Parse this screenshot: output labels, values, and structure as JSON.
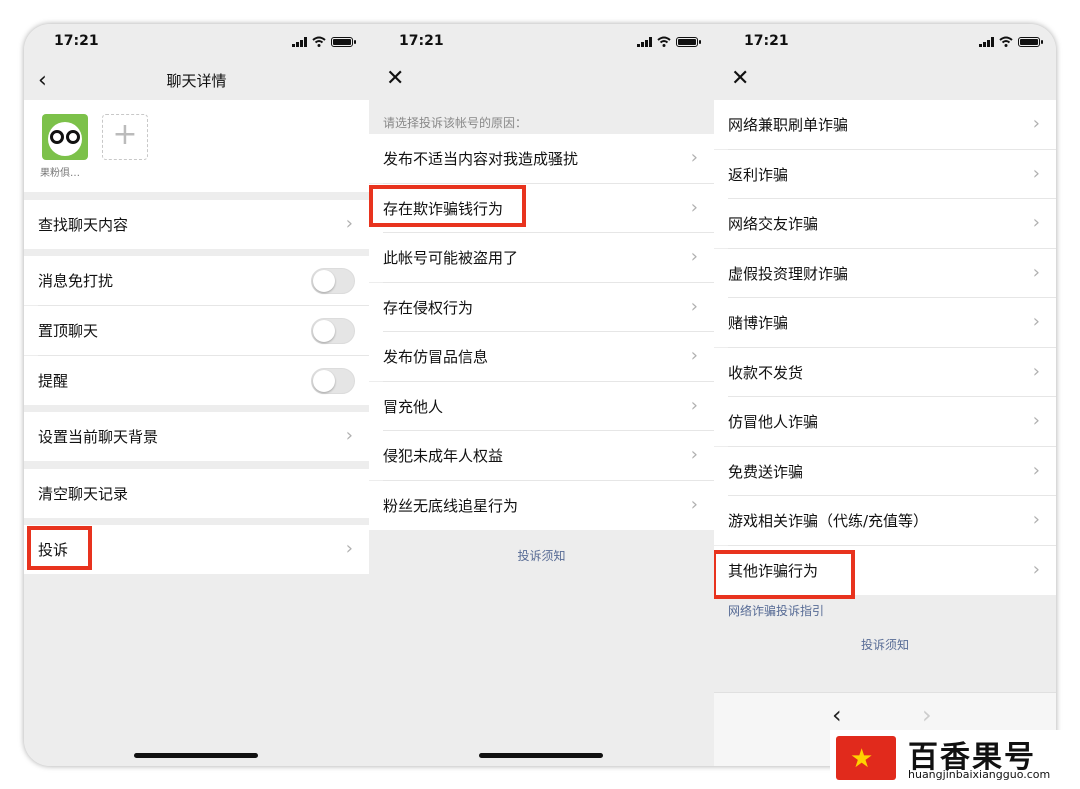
{
  "status_time": "17:21",
  "panel1": {
    "title": "聊天详情",
    "member_name": "果粉俱…",
    "rows": {
      "search": "查找聊天内容",
      "mute": "消息免打扰",
      "pin": "置顶聊天",
      "remind": "提醒",
      "background": "设置当前聊天背景",
      "clear": "清空聊天记录",
      "complain": "投诉"
    },
    "toggles": {
      "mute": false,
      "pin": false,
      "remind": false
    }
  },
  "panel2": {
    "hint": "请选择投诉该帐号的原因：",
    "reasons": [
      "发布不适当内容对我造成骚扰",
      "存在欺诈骗钱行为",
      "此帐号可能被盗用了",
      "存在侵权行为",
      "发布仿冒品信息",
      "冒充他人",
      "侵犯未成年人权益",
      "粉丝无底线追星行为"
    ],
    "footer": "投诉须知"
  },
  "panel3": {
    "items": [
      "网络兼职刷单诈骗",
      "返利诈骗",
      "网络交友诈骗",
      "虚假投资理财诈骗",
      "赌博诈骗",
      "收款不发货",
      "仿冒他人诈骗",
      "免费送诈骗",
      "游戏相关诈骗（代练/充值等）",
      "其他诈骗行为"
    ],
    "guide": "网络诈骗投诉指引",
    "footer": "投诉须知",
    "nav": {
      "prev": "‹",
      "next": "›"
    }
  },
  "watermark": {
    "cn": "百香果号",
    "en": "huangjinbaixiangguo.com"
  },
  "colors": {
    "highlight": "#e8331e",
    "link": "#576b95",
    "brand_red": "#e12a1c"
  }
}
